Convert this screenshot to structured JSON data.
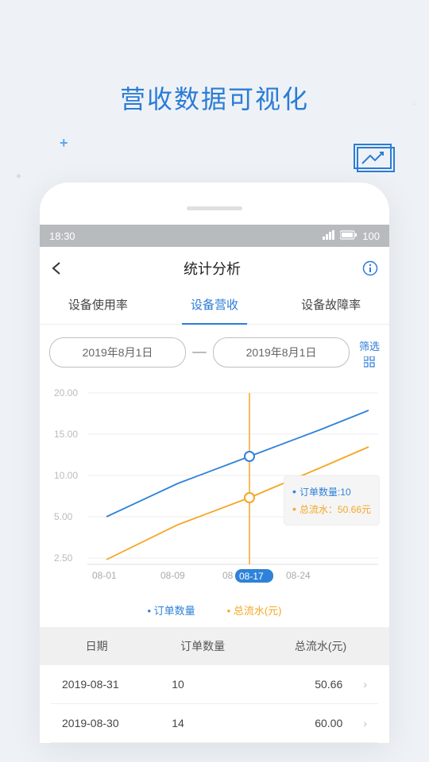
{
  "page_heading": "营收数据可视化",
  "status_bar": {
    "time": "18:30",
    "battery": "100"
  },
  "nav": {
    "title": "统计分析"
  },
  "tabs": {
    "items": [
      {
        "label": "设备使用率"
      },
      {
        "label": "设备营收"
      },
      {
        "label": "设备故障率"
      }
    ],
    "active_index": 1
  },
  "date_range": {
    "start": "2019年8月1日",
    "end": "2019年8月1日",
    "filter_label": "筛选"
  },
  "chart_data": {
    "type": "line",
    "y_ticks": [
      "20.00",
      "15.00",
      "10.00",
      "5.00",
      "2.50"
    ],
    "x_labels": [
      "08-01",
      "08-09",
      "08-17",
      "08-24"
    ],
    "highlighted_x": "08-17",
    "series": [
      {
        "name": "订单数量",
        "color": "#2e82d9",
        "values": [
          5,
          8,
          10,
          14,
          18
        ]
      },
      {
        "name": "总流水(元)",
        "color": "#f5a623",
        "values": [
          2.5,
          6,
          9,
          12,
          15
        ]
      }
    ],
    "tooltip": {
      "line1_label": "订单数量:",
      "line1_value": "10",
      "line2_label": "总流水：",
      "line2_value": "50.66元"
    }
  },
  "legend": {
    "item1": "订单数量",
    "item2": "总流水(元)"
  },
  "table": {
    "headers": {
      "col1": "日期",
      "col2": "订单数量",
      "col3": "总流水(元)"
    },
    "rows": [
      {
        "date": "2019-08-31",
        "orders": "10",
        "revenue": "50.66"
      },
      {
        "date": "2019-08-30",
        "orders": "14",
        "revenue": "60.00"
      }
    ]
  }
}
